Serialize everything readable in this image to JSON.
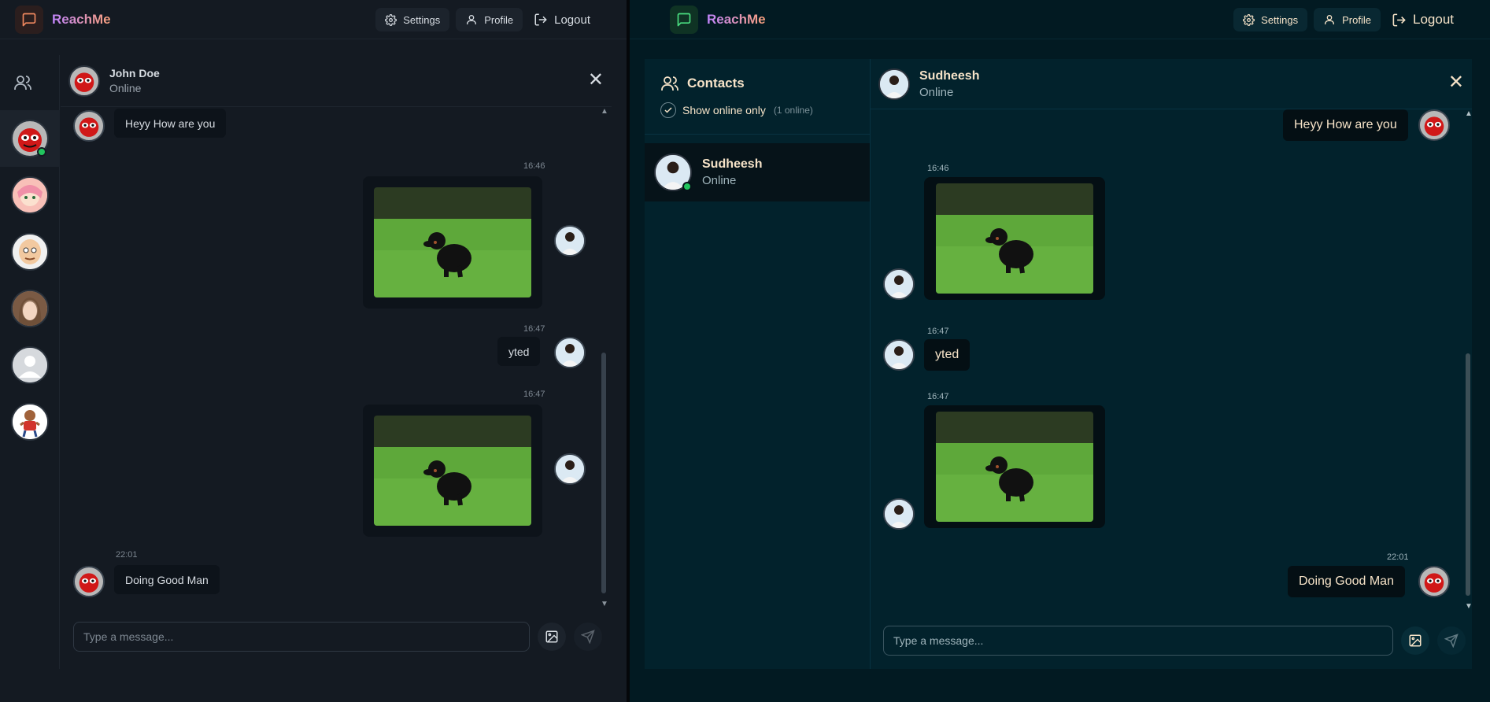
{
  "left": {
    "app_name": "ReachMe",
    "nav": {
      "settings": "Settings",
      "profile": "Profile",
      "logout": "Logout"
    },
    "chat": {
      "contact_name": "John Doe",
      "contact_status": "Online",
      "messages": [
        {
          "text": "Heyy How are you"
        },
        {
          "time": "16:46"
        },
        {
          "time": "16:47",
          "text": "yted"
        },
        {
          "time": "16:47"
        },
        {
          "time": "22:01",
          "text": "Doing Good Man"
        }
      ],
      "input_placeholder": "Type a message..."
    }
  },
  "right": {
    "app_name": "ReachMe",
    "nav": {
      "settings": "Settings",
      "profile": "Profile",
      "logout": "Logout"
    },
    "contacts": {
      "title": "Contacts",
      "online_only_label": "Show online only",
      "online_count": "(1 online)",
      "items": [
        {
          "name": "Sudheesh",
          "status": "Online"
        }
      ]
    },
    "chat": {
      "contact_name": "Sudheesh",
      "contact_status": "Online",
      "messages": [
        {
          "text": "Heyy How are you"
        },
        {
          "time": "16:46"
        },
        {
          "time": "16:47",
          "text": "yted"
        },
        {
          "time": "16:47"
        },
        {
          "time": "22:01",
          "text": "Doing Good Man"
        }
      ],
      "input_placeholder": "Type a message..."
    }
  }
}
